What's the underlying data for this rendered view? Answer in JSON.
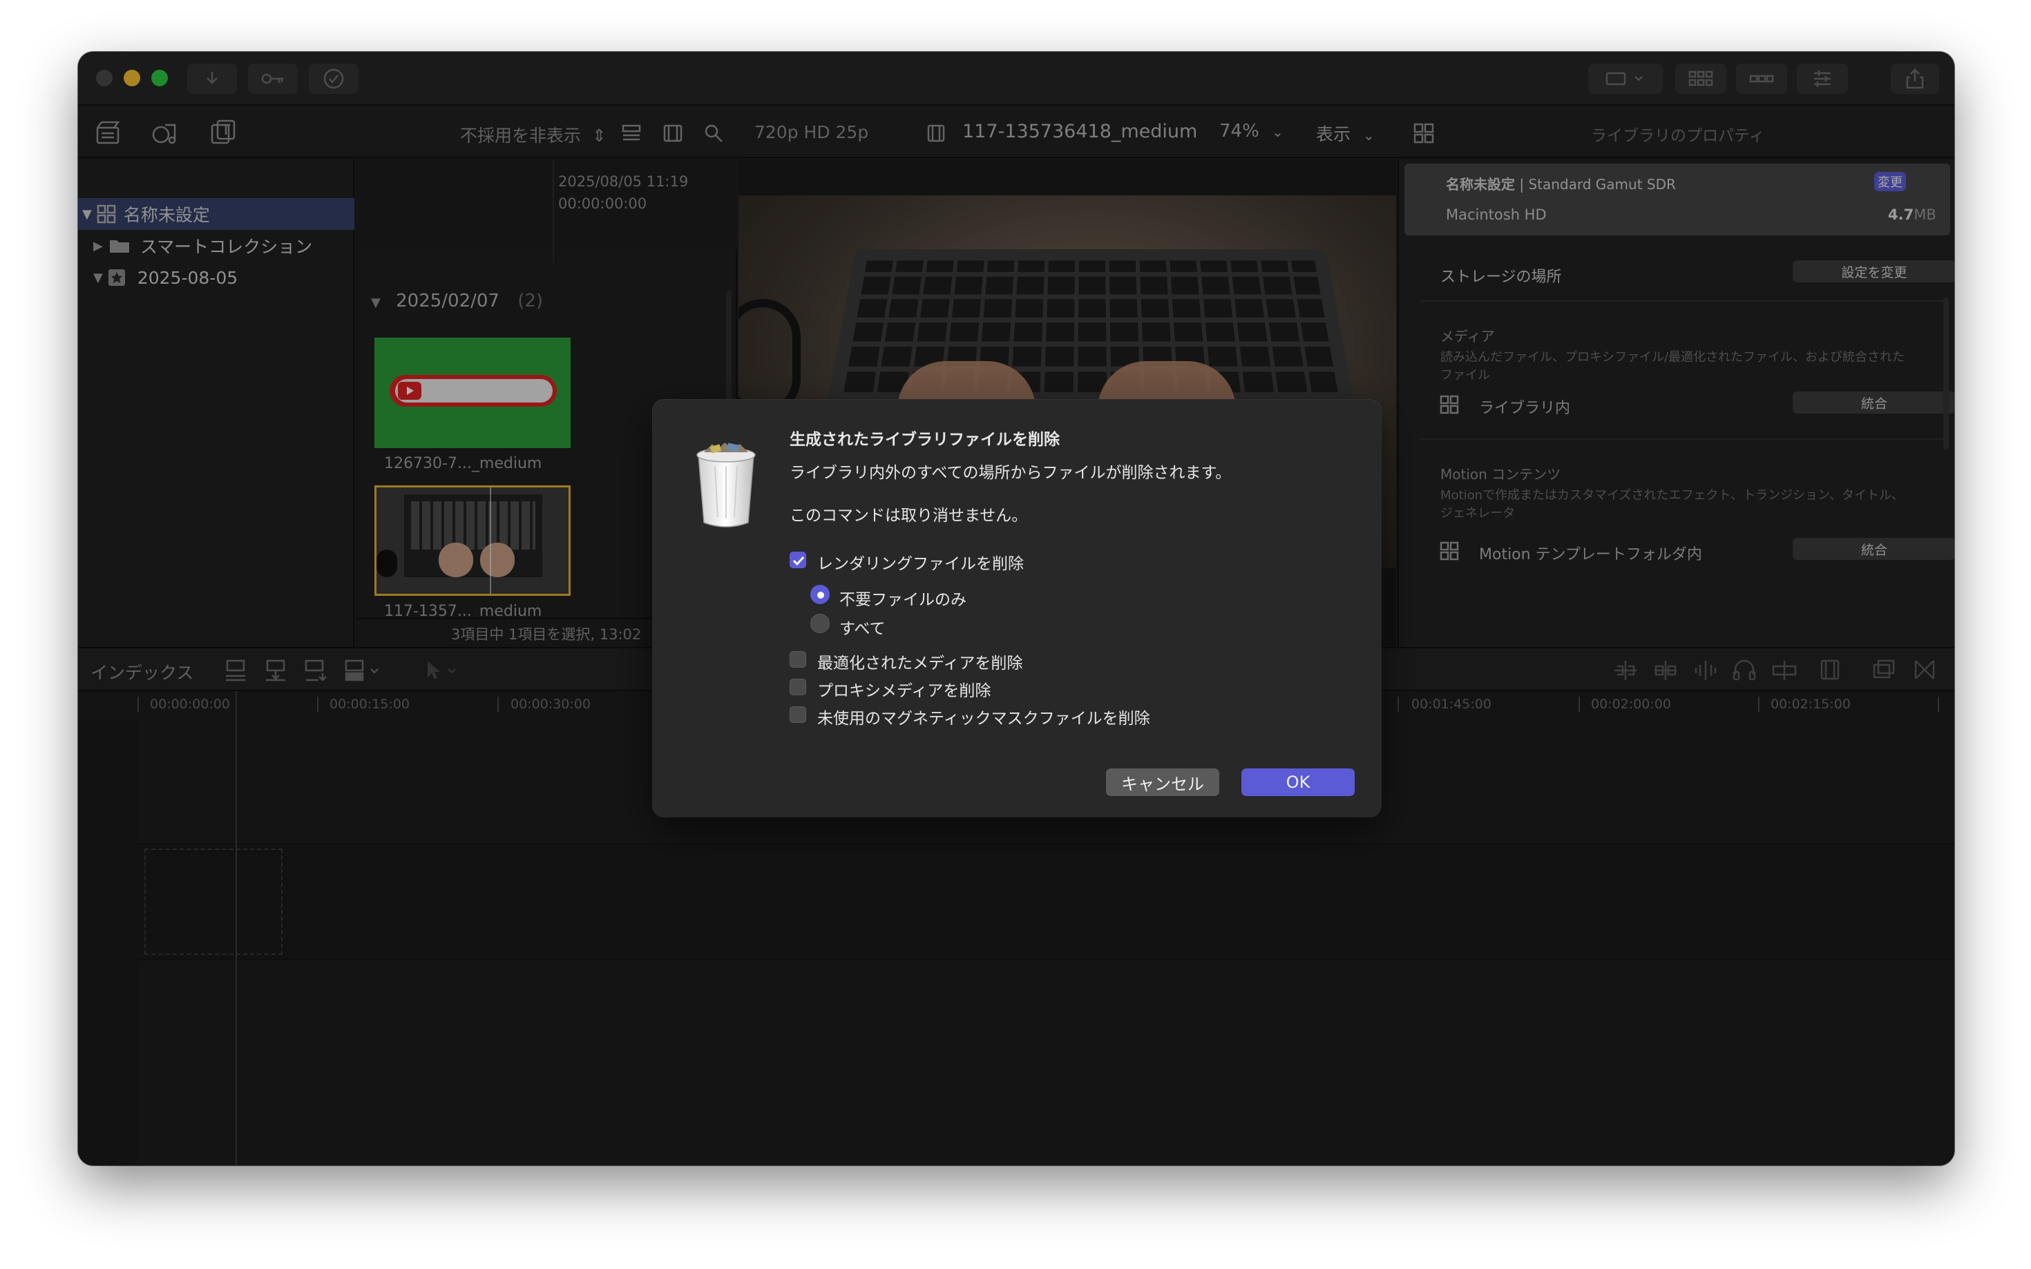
{
  "toolbar": {
    "filter_label": "不採用を非表示",
    "format": "720p HD 25p",
    "clip_name": "117-135736418_medium",
    "zoom": "74%",
    "view_label": "表示",
    "inspector_title": "ライブラリのプロパティ"
  },
  "sidebar": {
    "items": [
      {
        "label": "名称未設定"
      },
      {
        "label": "スマートコレクション"
      },
      {
        "label": "2025-08-05"
      }
    ]
  },
  "browser": {
    "top_date": "2025/08/05 11:19",
    "top_time": "00:00:00:00",
    "group_title": "2025/02/07",
    "group_count": "(2)",
    "clips": [
      {
        "name": "126730-7..._medium"
      },
      {
        "name": "117-1357..._medium"
      }
    ],
    "status": "3項目中 1項目を選択, 13:02"
  },
  "inspector": {
    "library_name": "名称未設定",
    "color_space": " | Standard Gamut SDR",
    "change_label": "変更",
    "disk": "Macintosh HD",
    "size": "4.7",
    "size_unit": "MB",
    "storage_label": "ストレージの場所",
    "storage_button": "設定を変更",
    "media_label": "メディア",
    "media_desc_1": "読み込んだファイル、プロキシファイル/最適化されたファイル、および統合された",
    "media_desc_2": "ファイル",
    "media_location": "ライブラリ内",
    "merge_label": "統合",
    "motion_label": "Motion コンテンツ",
    "motion_desc_1": "Motionで作成またはカスタマイズされたエフェクト、トランジション、タイトル、",
    "motion_desc_2": "ジェネレータ",
    "motion_location": "Motion テンプレートフォルダ内",
    "merge_label_2": "統合"
  },
  "timeline": {
    "index_label": "インデックス",
    "ruler": [
      "00:00:00:00",
      "00:00:15:00",
      "00:00:30:00",
      "00:01:45:00",
      "00:02:00:00",
      "00:02:15:00"
    ]
  },
  "dialog": {
    "title": "生成されたライブラリファイルを削除",
    "message": "ライブラリ内外のすべての場所からファイルが削除されます。",
    "warning": "このコマンドは取り消せません。",
    "render_label": "レンダリングファイルを削除",
    "render_checked": true,
    "radio_unused": "不要ファイルのみ",
    "radio_all": "すべて",
    "optimized_label": "最適化されたメディアを削除",
    "proxy_label": "プロキシメディアを削除",
    "mask_label": "未使用のマグネティックマスクファイルを削除",
    "cancel_label": "キャンセル",
    "ok_label": "OK",
    "accent": "#5b5bd6"
  }
}
